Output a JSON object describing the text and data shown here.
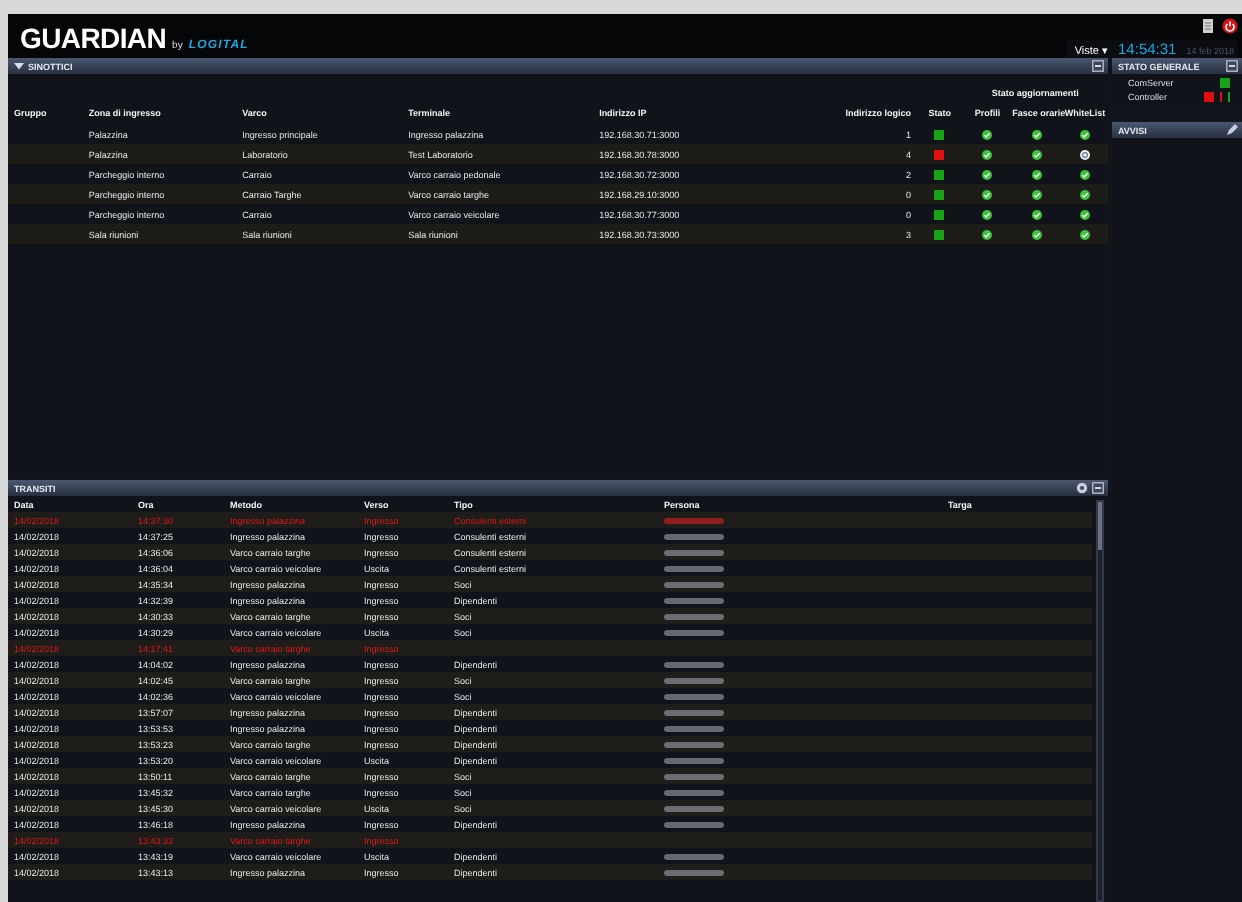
{
  "header": {
    "logo": "GUARDIAN",
    "logo_suffix_by": "by",
    "logo_brand": "LOGITAL",
    "views_menu": "Viste ▾",
    "clock": "14:54:31",
    "date": "14 feb 2018"
  },
  "sinottici": {
    "title": "SINOTTICI",
    "group_header": "Stato aggiornamenti",
    "columns": [
      "Gruppo",
      "Zona di ingresso",
      "Varco",
      "Terminale",
      "Indirizzo IP",
      "Indirizzo logico",
      "Stato",
      "Profili",
      "Fasce orarie",
      "WhiteList"
    ],
    "rows": [
      {
        "zona": "Palazzina",
        "varco": "Ingresso principale",
        "terminale": "Ingresso palazzina",
        "ip": "192.168.30.71:3000",
        "logico": "1",
        "color": "#17a317",
        "updates": [
          true,
          true,
          true
        ]
      },
      {
        "zona": "Palazzina",
        "varco": "Laboratorio",
        "terminale": "Test Laboratorio",
        "ip": "192.168.30.78:3000",
        "logico": "4",
        "color": "#e01010",
        "updates": [
          true,
          true,
          false
        ]
      },
      {
        "zona": "Parcheggio interno",
        "varco": "Carraio",
        "terminale": "Varco carraio pedonale",
        "ip": "192.168.30.72:3000",
        "logico": "2",
        "color": "#17a317",
        "updates": [
          true,
          true,
          true
        ]
      },
      {
        "zona": "Parcheggio interno",
        "varco": "Carraio Targhe",
        "terminale": "Varco carraio targhe",
        "ip": "192.168.29.10:3000",
        "logico": "0",
        "color": "#17a317",
        "updates": [
          true,
          true,
          true
        ]
      },
      {
        "zona": "Parcheggio interno",
        "varco": "Carraio",
        "terminale": "Varco carraio veicolare",
        "ip": "192.168.30.77:3000",
        "logico": "0",
        "color": "#17a317",
        "updates": [
          true,
          true,
          true
        ]
      },
      {
        "zona": "Sala riunioni",
        "varco": "Sala riunioni",
        "terminale": "Sala riunioni",
        "ip": "192.168.30.73:3000",
        "logico": "3",
        "color": "#17a317",
        "updates": [
          true,
          true,
          true
        ]
      }
    ]
  },
  "transiti": {
    "title": "TRANSITI",
    "columns": [
      "Data",
      "Ora",
      "Metodo",
      "Verso",
      "Tipo",
      "Persona",
      "Targa"
    ],
    "rows": [
      {
        "alarm": true,
        "data": "14/02/2018",
        "ora": "14:37:30",
        "metodo": "Ingresso palazzina",
        "verso": "Ingresso",
        "tipo": "Consulenti esterni",
        "persona": true
      },
      {
        "alarm": false,
        "data": "14/02/2018",
        "ora": "14:37:25",
        "metodo": "Ingresso palazzina",
        "verso": "Ingresso",
        "tipo": "Consulenti esterni",
        "persona": true
      },
      {
        "alarm": false,
        "data": "14/02/2018",
        "ora": "14:36:06",
        "metodo": "Varco carraio targhe",
        "verso": "Ingresso",
        "tipo": "Consulenti esterni",
        "persona": true
      },
      {
        "alarm": false,
        "data": "14/02/2018",
        "ora": "14:36:04",
        "metodo": "Varco carraio veicolare",
        "verso": "Uscita",
        "tipo": "Consulenti esterni",
        "persona": true
      },
      {
        "alarm": false,
        "data": "14/02/2018",
        "ora": "14:35:34",
        "metodo": "Ingresso palazzina",
        "verso": "Ingresso",
        "tipo": "Soci",
        "persona": true
      },
      {
        "alarm": false,
        "data": "14/02/2018",
        "ora": "14:32:39",
        "metodo": "Ingresso palazzina",
        "verso": "Ingresso",
        "tipo": "Dipendenti",
        "persona": true
      },
      {
        "alarm": false,
        "data": "14/02/2018",
        "ora": "14:30:33",
        "metodo": "Varco carraio targhe",
        "verso": "Ingresso",
        "tipo": "Soci",
        "persona": true
      },
      {
        "alarm": false,
        "data": "14/02/2018",
        "ora": "14:30:29",
        "metodo": "Varco carraio veicolare",
        "verso": "Uscita",
        "tipo": "Soci",
        "persona": true
      },
      {
        "alarm": true,
        "data": "14/02/2018",
        "ora": "14:17:41",
        "metodo": "Varco carraio targhe",
        "verso": "Ingresso",
        "persona": false
      },
      {
        "alarm": false,
        "data": "14/02/2018",
        "ora": "14:04:02",
        "metodo": "Ingresso palazzina",
        "verso": "Ingresso",
        "tipo": "Dipendenti",
        "persona": true
      },
      {
        "alarm": false,
        "data": "14/02/2018",
        "ora": "14:02:45",
        "metodo": "Varco carraio targhe",
        "verso": "Ingresso",
        "tipo": "Soci",
        "persona": true
      },
      {
        "alarm": false,
        "data": "14/02/2018",
        "ora": "14:02:36",
        "metodo": "Varco carraio veicolare",
        "verso": "Ingresso",
        "tipo": "Soci",
        "persona": true
      },
      {
        "alarm": false,
        "data": "14/02/2018",
        "ora": "13:57:07",
        "metodo": "Ingresso palazzina",
        "verso": "Ingresso",
        "tipo": "Dipendenti",
        "persona": true
      },
      {
        "alarm": false,
        "data": "14/02/2018",
        "ora": "13:53:53",
        "metodo": "Ingresso palazzina",
        "verso": "Ingresso",
        "tipo": "Dipendenti",
        "persona": true
      },
      {
        "alarm": false,
        "data": "14/02/2018",
        "ora": "13:53:23",
        "metodo": "Varco carraio targhe",
        "verso": "Ingresso",
        "tipo": "Dipendenti",
        "persona": true
      },
      {
        "alarm": false,
        "data": "14/02/2018",
        "ora": "13:53:20",
        "metodo": "Varco carraio veicolare",
        "verso": "Uscita",
        "tipo": "Dipendenti",
        "persona": true
      },
      {
        "alarm": false,
        "data": "14/02/2018",
        "ora": "13:50:11",
        "metodo": "Varco carraio targhe",
        "verso": "Ingresso",
        "tipo": "Soci",
        "persona": true
      },
      {
        "alarm": false,
        "data": "14/02/2018",
        "ora": "13:45:32",
        "metodo": "Varco carraio targhe",
        "verso": "Ingresso",
        "tipo": "Soci",
        "persona": true
      },
      {
        "alarm": false,
        "data": "14/02/2018",
        "ora": "13:45:30",
        "metodo": "Varco carraio veicolare",
        "verso": "Uscita",
        "tipo": "Soci",
        "persona": true
      },
      {
        "alarm": false,
        "data": "14/02/2018",
        "ora": "13:46:18",
        "metodo": "Ingresso palazzina",
        "verso": "Ingresso",
        "tipo": "Dipendenti",
        "persona": true
      },
      {
        "alarm": true,
        "data": "14/02/2018",
        "ora": "13:43:33",
        "metodo": "Varco carraio targhe",
        "verso": "Ingresso",
        "persona": false
      },
      {
        "alarm": false,
        "data": "14/02/2018",
        "ora": "13:43:19",
        "metodo": "Varco carraio veicolare",
        "verso": "Uscita",
        "tipo": "Dipendenti",
        "persona": true
      },
      {
        "alarm": false,
        "data": "14/02/2018",
        "ora": "13:43:13",
        "metodo": "Ingresso palazzina",
        "verso": "Ingresso",
        "tipo": "Dipendenti",
        "persona": true
      }
    ]
  },
  "stato_generale": {
    "title": "STATO GENERALE",
    "items": [
      {
        "label": "ComServer",
        "indicators": [
          {
            "color": "#17a317"
          }
        ]
      },
      {
        "label": "Controller",
        "indicators": [
          {
            "color": "#e01010"
          },
          {
            "color": "#e01010"
          },
          {
            "color": "#17a317"
          }
        ]
      }
    ]
  },
  "avvisi": {
    "title": "AVVISI"
  }
}
